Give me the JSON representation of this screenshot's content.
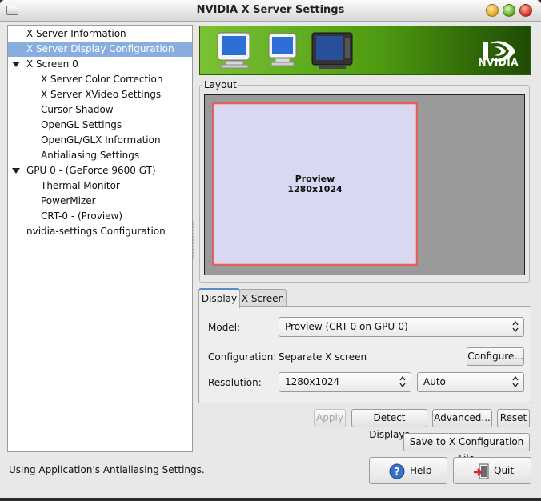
{
  "window": {
    "title": "NVIDIA X Server Settings",
    "colors": {
      "selection": "#88aee0",
      "banner": "#76b900",
      "screen_fill": "#d8d8f2",
      "screen_border": "#e06060"
    }
  },
  "sidebar": {
    "items": [
      {
        "label": "X Server Information",
        "level": 1,
        "expander": false,
        "selected": false
      },
      {
        "label": "X Server Display Configuration",
        "level": 1,
        "expander": false,
        "selected": true
      },
      {
        "label": "X Screen 0",
        "level": 1,
        "expander": true,
        "selected": false
      },
      {
        "label": "X Server Color Correction",
        "level": 2,
        "expander": false,
        "selected": false
      },
      {
        "label": "X Server XVideo Settings",
        "level": 2,
        "expander": false,
        "selected": false
      },
      {
        "label": "Cursor Shadow",
        "level": 2,
        "expander": false,
        "selected": false
      },
      {
        "label": "OpenGL Settings",
        "level": 2,
        "expander": false,
        "selected": false
      },
      {
        "label": "OpenGL/GLX Information",
        "level": 2,
        "expander": false,
        "selected": false
      },
      {
        "label": "Antialiasing Settings",
        "level": 2,
        "expander": false,
        "selected": false
      },
      {
        "label": "GPU 0 - (GeForce 9600 GT)",
        "level": 1,
        "expander": true,
        "selected": false
      },
      {
        "label": "Thermal Monitor",
        "level": 2,
        "expander": false,
        "selected": false
      },
      {
        "label": "PowerMizer",
        "level": 2,
        "expander": false,
        "selected": false
      },
      {
        "label": "CRT-0 - (Proview)",
        "level": 2,
        "expander": false,
        "selected": false
      },
      {
        "label": "nvidia-settings Configuration",
        "level": 1,
        "expander": false,
        "selected": false
      }
    ]
  },
  "banner": {
    "logo_text": "NVIDIA",
    "icons": [
      "crt-monitor-icon",
      "crt-monitor-icon",
      "tv-monitor-icon",
      "nvidia-eye-icon"
    ]
  },
  "layout": {
    "legend": "Layout",
    "screen_name": "Proview",
    "screen_resolution": "1280x1024"
  },
  "tabs": [
    {
      "label": "Display",
      "active": true
    },
    {
      "label": "X Screen",
      "active": false
    }
  ],
  "display": {
    "model_label": "Model:",
    "model_value": "Proview (CRT-0 on GPU-0)",
    "configuration_label": "Configuration:",
    "configuration_value": "Separate X screen",
    "configure_button": "Configure...",
    "resolution_label": "Resolution:",
    "resolution_value": "1280x1024",
    "refresh_value": "Auto"
  },
  "actions": {
    "apply": "Apply",
    "detect": "Detect Displays",
    "advanced": "Advanced...",
    "reset": "Reset",
    "save": "Save to X Configuration File"
  },
  "status_text": "Using Application's Antialiasing Settings.",
  "footer": {
    "help": "Help",
    "quit": "Quit"
  }
}
